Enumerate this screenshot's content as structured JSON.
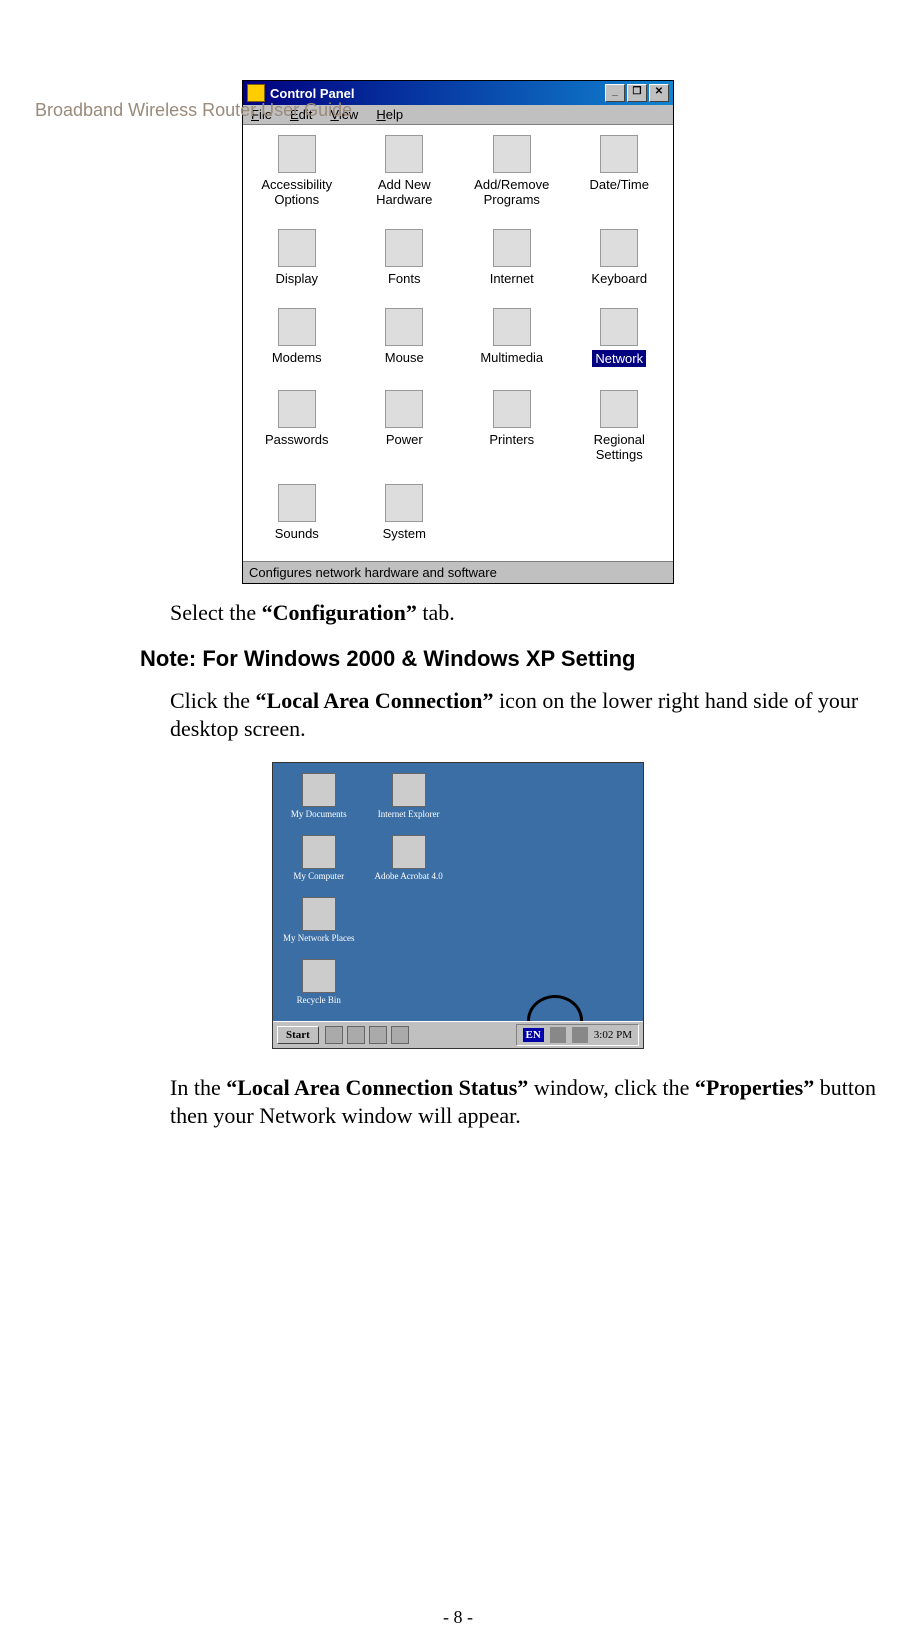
{
  "header": "Broadband Wireless Router User Guide",
  "control_panel": {
    "title": "Control Panel",
    "menu": {
      "file": "File",
      "edit": "Edit",
      "view": "View",
      "help": "Help"
    },
    "items": [
      {
        "label": "Accessibility\nOptions"
      },
      {
        "label": "Add New\nHardware"
      },
      {
        "label": "Add/Remove\nPrograms"
      },
      {
        "label": "Date/Time"
      },
      {
        "label": "Display"
      },
      {
        "label": "Fonts"
      },
      {
        "label": "Internet"
      },
      {
        "label": "Keyboard"
      },
      {
        "label": "Modems"
      },
      {
        "label": "Mouse"
      },
      {
        "label": "Multimedia"
      },
      {
        "label": "Network",
        "selected": true
      },
      {
        "label": "Passwords"
      },
      {
        "label": "Power"
      },
      {
        "label": "Printers"
      },
      {
        "label": "Regional\nSettings"
      },
      {
        "label": "Sounds"
      },
      {
        "label": "System"
      }
    ],
    "statusbar": "Configures network hardware and software"
  },
  "text": {
    "select_config_pre": "Select the ",
    "select_config_bold": "“Configuration”",
    "select_config_post": " tab.",
    "note_heading": "Note: For Windows 2000 & Windows XP Setting",
    "click_lac_pre": "Click the ",
    "click_lac_bold": "“Local Area Connection”",
    "click_lac_post": " icon on the lower right hand side of your desktop screen.",
    "in_lacs_pre": "In the ",
    "in_lacs_bold1": "“Local Area Connection Status”",
    "in_lacs_mid": " window, click the ",
    "in_lacs_bold2": "“Properties”",
    "in_lacs_post": " button then your Network window will appear."
  },
  "desktop": {
    "icons_col1": [
      "My Documents",
      "My Computer",
      "My Network Places",
      "Recycle Bin"
    ],
    "icons_col2": [
      "Internet Explorer",
      "Adobe Acrobat 4.0"
    ],
    "start": "Start",
    "en": "EN",
    "time": "3:02 PM"
  },
  "page_number": "- 8 -"
}
